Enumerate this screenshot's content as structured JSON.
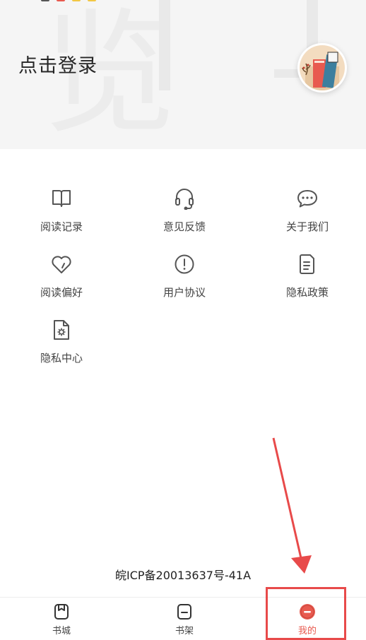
{
  "header": {
    "login_text": "点击登录",
    "watermark_char": "览",
    "status_dot_colors": [
      "#555555",
      "#e85a4f",
      "#f2c744",
      "#f2c744"
    ]
  },
  "menu": {
    "items": [
      {
        "label": "阅读记录",
        "icon": "book-open-icon"
      },
      {
        "label": "意见反馈",
        "icon": "headset-icon"
      },
      {
        "label": "关于我们",
        "icon": "chat-bubble-icon"
      },
      {
        "label": "阅读偏好",
        "icon": "heart-icon"
      },
      {
        "label": "用户协议",
        "icon": "info-circle-icon"
      },
      {
        "label": "隐私政策",
        "icon": "document-icon"
      },
      {
        "label": "隐私中心",
        "icon": "settings-file-icon"
      }
    ]
  },
  "footer": {
    "icp": "皖ICP备20013637号-41A"
  },
  "tabbar": {
    "tabs": [
      {
        "label": "书城",
        "icon": "bookstore-icon",
        "active": false
      },
      {
        "label": "书架",
        "icon": "bookshelf-icon",
        "active": false
      },
      {
        "label": "我的",
        "icon": "profile-icon",
        "active": true
      }
    ]
  },
  "colors": {
    "accent": "#e85a4f",
    "annotation": "#e84a4a",
    "icon_stroke": "#555555"
  }
}
